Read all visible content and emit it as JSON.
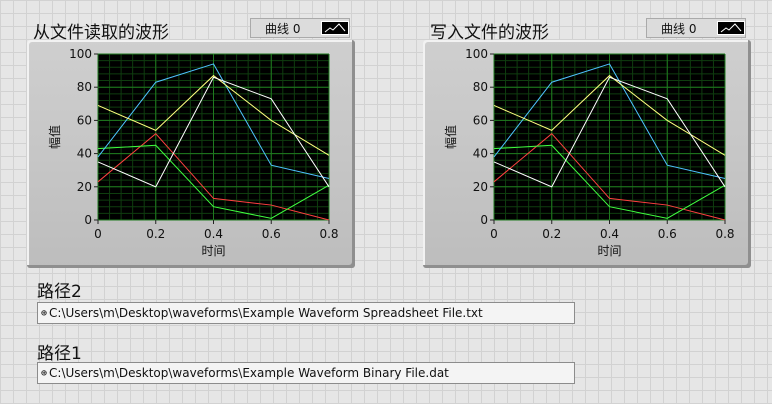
{
  "graphs": [
    {
      "id": "graph-from-file",
      "title": "从文件读取的波形",
      "legend_label": "曲线 0",
      "y_axis_label": "幅值",
      "x_axis_label": "时间",
      "x_ticks": [
        "0",
        "0.2",
        "0.4",
        "0.6",
        "0.8"
      ],
      "y_ticks": [
        "0",
        "20",
        "40",
        "60",
        "80",
        "100"
      ]
    },
    {
      "id": "graph-written",
      "title": "写入文件的波形",
      "legend_label": "曲线 0",
      "y_axis_label": "幅值",
      "x_axis_label": "时间",
      "x_ticks": [
        "0",
        "0.2",
        "0.4",
        "0.6",
        "0.8"
      ],
      "y_ticks": [
        "0",
        "20",
        "40",
        "60",
        "80",
        "100"
      ]
    }
  ],
  "chart_data": {
    "type": "line",
    "x": [
      0,
      0.2,
      0.4,
      0.6,
      0.8
    ],
    "xlabel": "时间",
    "ylabel": "幅值",
    "xlim": [
      0,
      0.8
    ],
    "ylim": [
      0,
      100
    ],
    "grid": true,
    "series": [
      {
        "color": "#ff4040",
        "values": [
          23,
          52,
          13,
          9,
          0
        ]
      },
      {
        "color": "#40ff40",
        "values": [
          43,
          45,
          8,
          1,
          21
        ]
      },
      {
        "color": "#4fc3ff",
        "values": [
          38,
          83,
          94,
          33,
          25
        ]
      },
      {
        "color": "#ffff80",
        "values": [
          69,
          54,
          87,
          60,
          39
        ]
      },
      {
        "color": "#ffffff",
        "values": [
          35,
          20,
          86,
          73,
          20
        ]
      }
    ]
  },
  "paths": [
    {
      "label": "路径2",
      "icon": "path-icon",
      "value": "C:\\Users\\m\\Desktop\\waveforms\\Example Waveform Spreadsheet File.txt"
    },
    {
      "label": "路径1",
      "icon": "path-icon",
      "value": "C:\\Users\\m\\Desktop\\waveforms\\Example Waveform Binary File.dat"
    }
  ],
  "colors": {
    "plot_bg": "#000000",
    "grid": "#1f7a1f",
    "frame": "#c8c8c8"
  }
}
